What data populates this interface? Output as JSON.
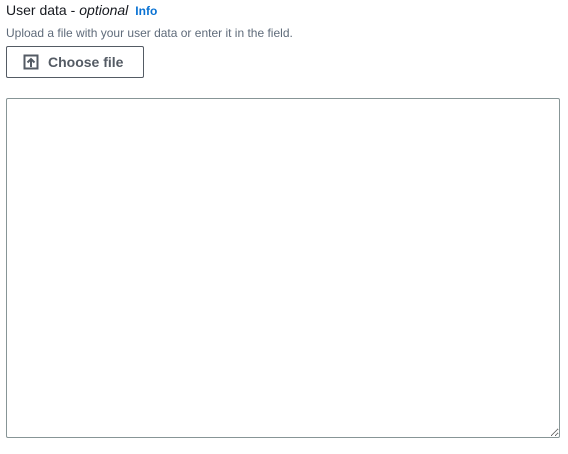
{
  "field": {
    "label": "User data -",
    "optional_label": "optional",
    "info_link": "Info",
    "description": "Upload a file with your user data or enter it in the field.",
    "choose_button": {
      "label": "Choose file",
      "icon": "upload-icon"
    },
    "textarea": {
      "value": "",
      "placeholder": ""
    }
  },
  "colors": {
    "text": "#16191f",
    "description": "#5f6b7a",
    "link": "#0972d3",
    "button_border": "#545b64",
    "input_border": "#879596"
  }
}
